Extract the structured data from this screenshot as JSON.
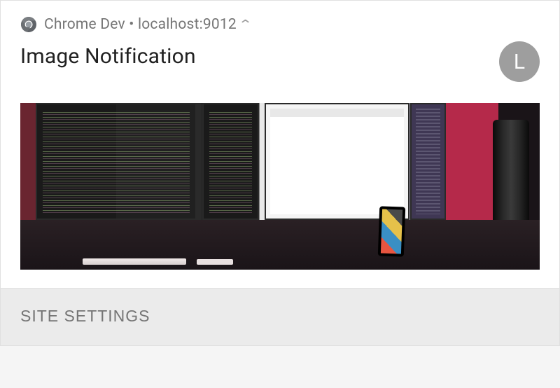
{
  "header": {
    "app_name": "Chrome Dev",
    "separator": " • ",
    "origin": "localhost:9012"
  },
  "notification": {
    "title": "Image Notification",
    "avatar_letter": "L"
  },
  "actions": {
    "site_settings": "SITE SETTINGS"
  }
}
